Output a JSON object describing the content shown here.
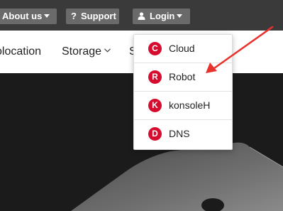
{
  "topbar": {
    "about_label": "About us",
    "support_label": "Support",
    "support_icon": "?",
    "login_label": "Login"
  },
  "nav": {
    "colocation": "olocation",
    "storage": "Storage",
    "cut": "S"
  },
  "dropdown": {
    "items": [
      {
        "label": "Cloud",
        "icon_glyph": "C",
        "icon": "cloud-icon"
      },
      {
        "label": "Robot",
        "icon_glyph": "R",
        "icon": "robot-icon"
      },
      {
        "label": "konsoleH",
        "icon_glyph": "K",
        "icon": "konsoleh-icon"
      },
      {
        "label": "DNS",
        "icon_glyph": "D",
        "icon": "dns-icon"
      }
    ]
  },
  "colors": {
    "topbar_bg": "#3a3a3a",
    "button_bg": "#6a6a6a",
    "brand_red": "#d50c2d",
    "arrow_red": "#e8322d",
    "hero_bg": "#1b1b1b"
  }
}
